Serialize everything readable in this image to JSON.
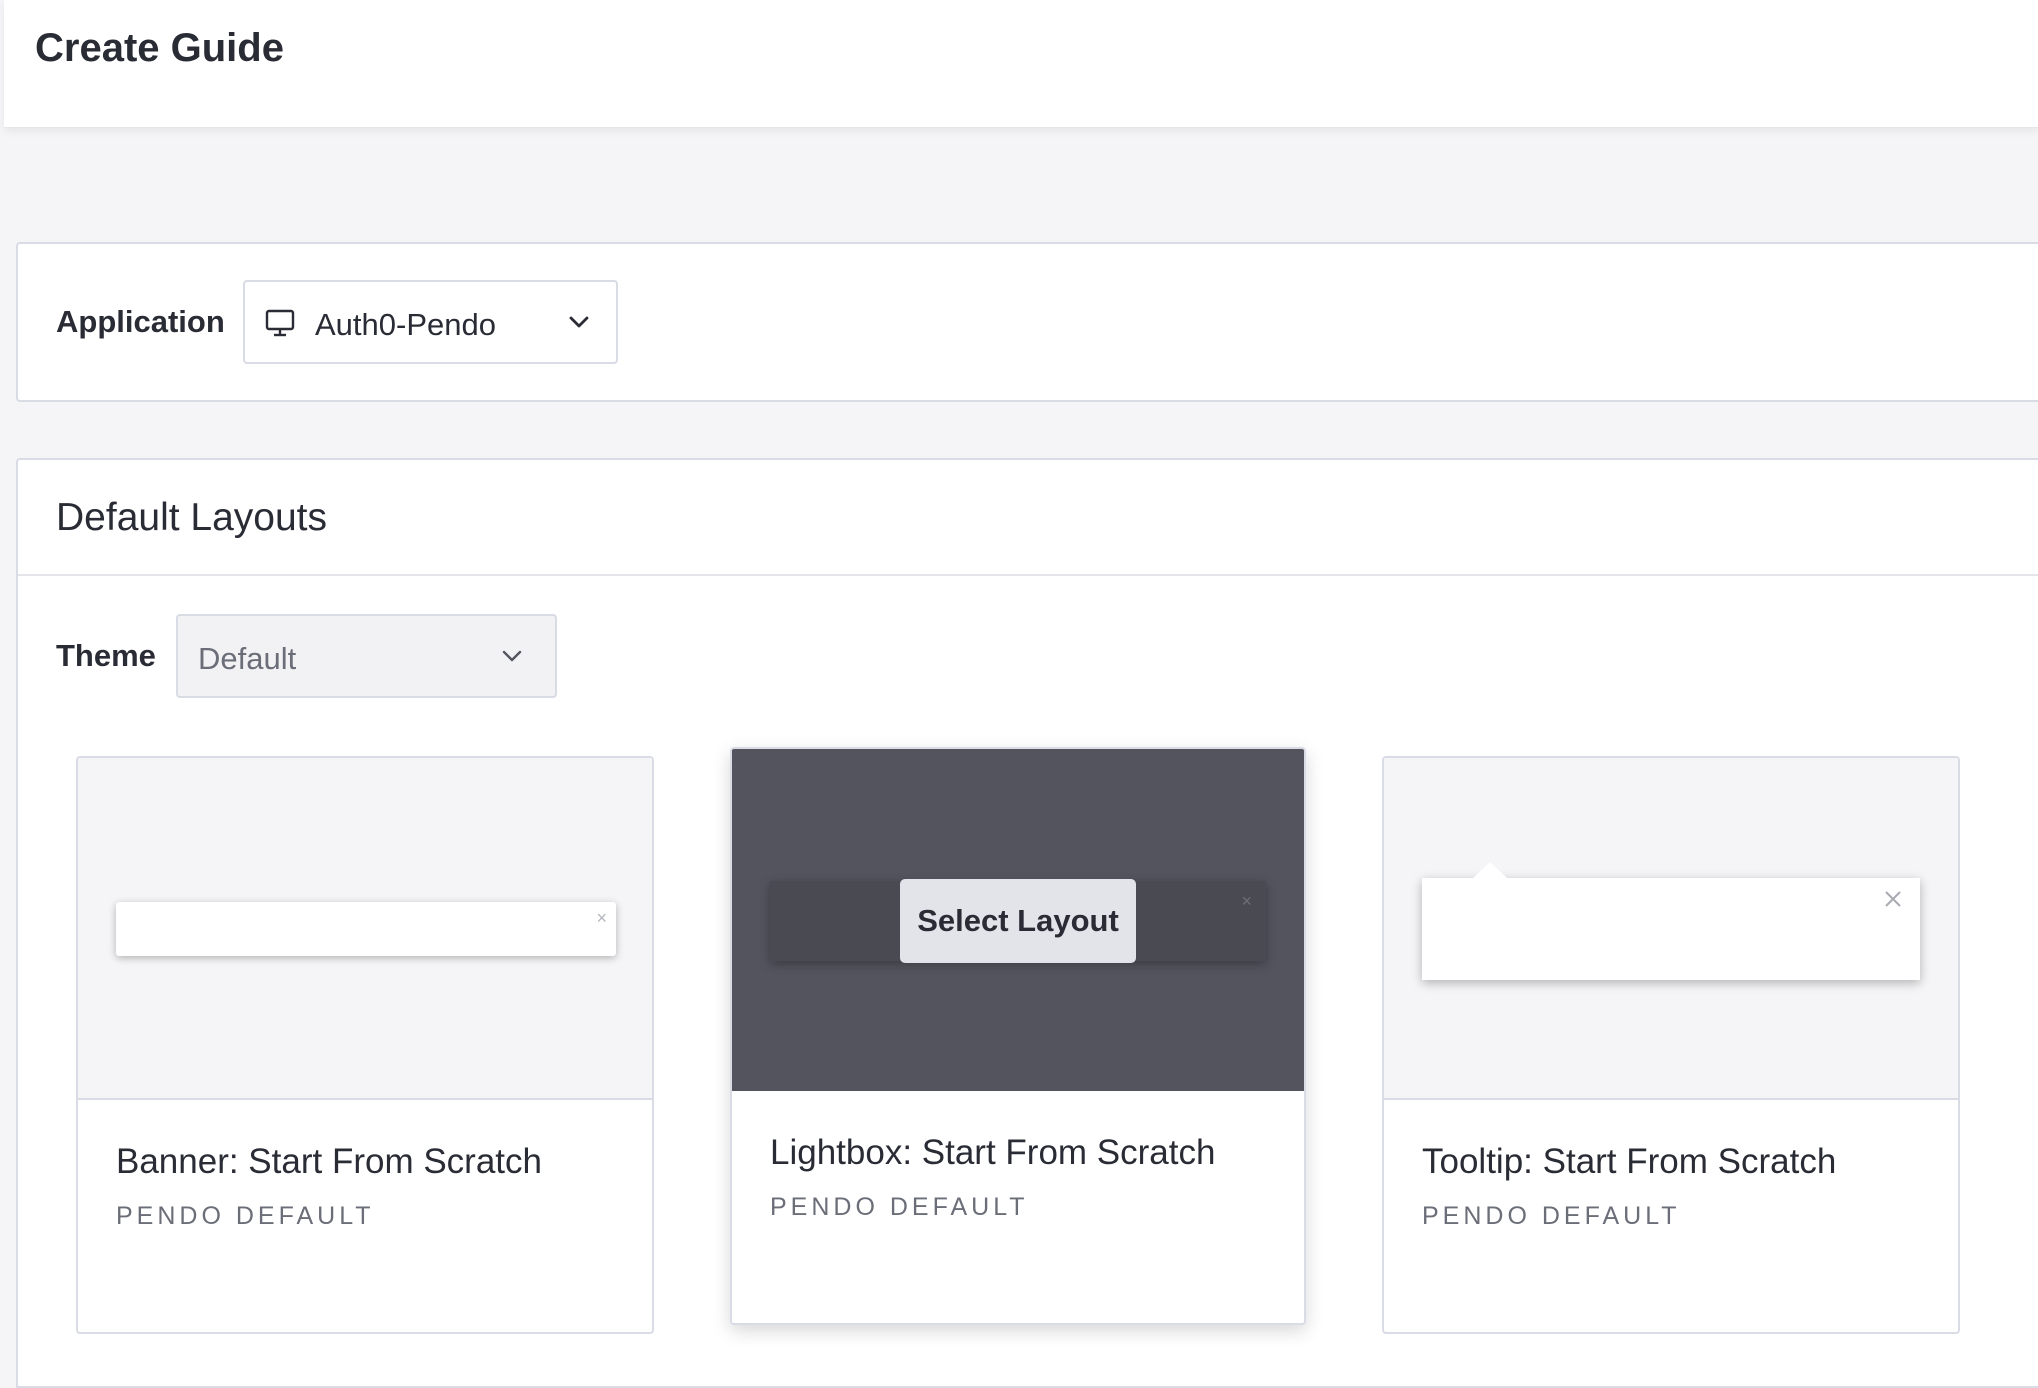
{
  "header": {
    "title": "Create Guide"
  },
  "application": {
    "label": "Application",
    "selected": "Auth0-Pendo",
    "icon": "monitor-icon"
  },
  "layouts": {
    "title": "Default Layouts",
    "theme": {
      "label": "Theme",
      "selected": "Default"
    },
    "cards": [
      {
        "title": "Banner: Start From Scratch",
        "subtitle": "PENDO DEFAULT",
        "type": "banner"
      },
      {
        "title": "Lightbox: Start From Scratch",
        "subtitle": "PENDO DEFAULT",
        "type": "lightbox",
        "hover_action": "Select Layout"
      },
      {
        "title": "Tooltip: Start From Scratch",
        "subtitle": "PENDO DEFAULT",
        "type": "tooltip"
      }
    ]
  },
  "colors": {
    "text": "#2a2c35",
    "muted": "#6b6e78",
    "border": "#dadce5",
    "lightbox_overlay": "#54545e",
    "background": "#f5f5f7"
  }
}
